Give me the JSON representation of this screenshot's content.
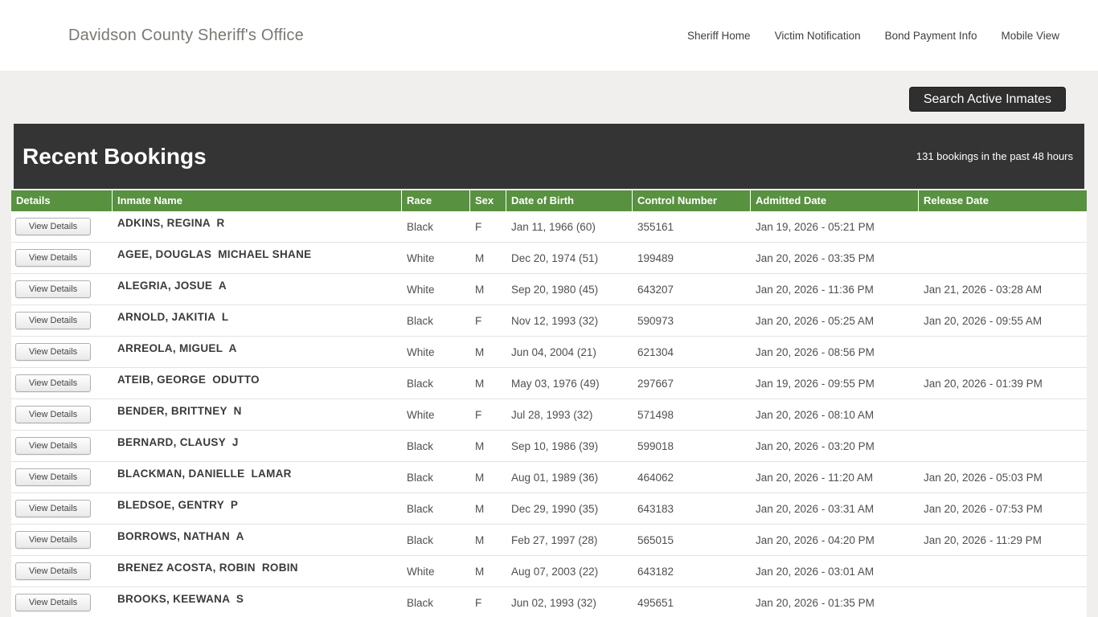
{
  "header": {
    "title": "Davidson County Sheriff's Office",
    "nav": [
      {
        "label": "Sheriff Home"
      },
      {
        "label": "Victim Notification"
      },
      {
        "label": "Bond Payment Info"
      },
      {
        "label": "Mobile View"
      }
    ]
  },
  "search_button_label": "Search Active Inmates",
  "bookings": {
    "title": "Recent Bookings",
    "subtitle": "131 bookings in the past 48 hours"
  },
  "colors": {
    "table_header_green": "#589140",
    "banner_dark": "#343434",
    "search_button_dark": "#2f2f2f",
    "page_background": "#f0efee"
  },
  "table": {
    "columns": [
      "Details",
      "Inmate Name",
      "Race",
      "Sex",
      "Date of Birth",
      "Control Number",
      "Admitted Date",
      "Release Date"
    ],
    "view_details_label": "View Details",
    "rows": [
      {
        "name": "ADKINS, REGINA  R",
        "race": "Black",
        "sex": "F",
        "dob": "Jan 11, 1966 (60)",
        "control": "355161",
        "admitted": "Jan 19, 2026 - 05:21 PM",
        "released": ""
      },
      {
        "name": "AGEE, DOUGLAS  MICHAEL SHANE",
        "race": "White",
        "sex": "M",
        "dob": "Dec 20, 1974 (51)",
        "control": "199489",
        "admitted": "Jan 20, 2026 - 03:35 PM",
        "released": ""
      },
      {
        "name": "ALEGRIA, JOSUE  A",
        "race": "White",
        "sex": "M",
        "dob": "Sep 20, 1980 (45)",
        "control": "643207",
        "admitted": "Jan 20, 2026 - 11:36 PM",
        "released": "Jan 21, 2026 - 03:28 AM"
      },
      {
        "name": "ARNOLD, JAKITIA  L",
        "race": "Black",
        "sex": "F",
        "dob": "Nov 12, 1993 (32)",
        "control": "590973",
        "admitted": "Jan 20, 2026 - 05:25 AM",
        "released": "Jan 20, 2026 - 09:55 AM"
      },
      {
        "name": "ARREOLA, MIGUEL  A",
        "race": "White",
        "sex": "M",
        "dob": "Jun 04, 2004 (21)",
        "control": "621304",
        "admitted": "Jan 20, 2026 - 08:56 PM",
        "released": ""
      },
      {
        "name": "ATEIB, GEORGE  ODUTTO",
        "race": "Black",
        "sex": "M",
        "dob": "May 03, 1976 (49)",
        "control": "297667",
        "admitted": "Jan 19, 2026 - 09:55 PM",
        "released": "Jan 20, 2026 - 01:39 PM"
      },
      {
        "name": "BENDER, BRITTNEY  N",
        "race": "White",
        "sex": "F",
        "dob": "Jul 28, 1993 (32)",
        "control": "571498",
        "admitted": "Jan 20, 2026 - 08:10 AM",
        "released": ""
      },
      {
        "name": "BERNARD, CLAUSY  J",
        "race": "Black",
        "sex": "M",
        "dob": "Sep 10, 1986 (39)",
        "control": "599018",
        "admitted": "Jan 20, 2026 - 03:20 PM",
        "released": ""
      },
      {
        "name": "BLACKMAN, DANIELLE  LAMAR",
        "race": "Black",
        "sex": "M",
        "dob": "Aug 01, 1989 (36)",
        "control": "464062",
        "admitted": "Jan 20, 2026 - 11:20 AM",
        "released": "Jan 20, 2026 - 05:03 PM"
      },
      {
        "name": "BLEDSOE, GENTRY  P",
        "race": "Black",
        "sex": "M",
        "dob": "Dec 29, 1990 (35)",
        "control": "643183",
        "admitted": "Jan 20, 2026 - 03:31 AM",
        "released": "Jan 20, 2026 - 07:53 PM"
      },
      {
        "name": "BORROWS, NATHAN  A",
        "race": "Black",
        "sex": "M",
        "dob": "Feb 27, 1997 (28)",
        "control": "565015",
        "admitted": "Jan 20, 2026 - 04:20 PM",
        "released": "Jan 20, 2026 - 11:29 PM"
      },
      {
        "name": "BRENEZ ACOSTA, ROBIN  ROBIN",
        "race": "White",
        "sex": "M",
        "dob": "Aug 07, 2003 (22)",
        "control": "643182",
        "admitted": "Jan 20, 2026 - 03:01 AM",
        "released": ""
      },
      {
        "name": "BROOKS, KEEWANA  S",
        "race": "Black",
        "sex": "F",
        "dob": "Jun 02, 1993 (32)",
        "control": "495651",
        "admitted": "Jan 20, 2026 - 01:35 PM",
        "released": ""
      }
    ]
  }
}
